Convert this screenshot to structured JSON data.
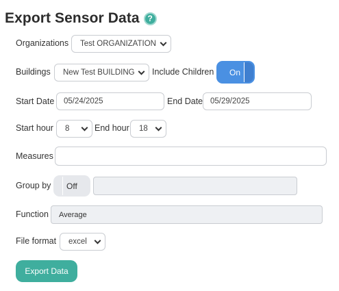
{
  "header": {
    "title": "Export Sensor Data",
    "help_icon_glyph": "?"
  },
  "form": {
    "organizations": {
      "label": "Organizations",
      "value": "Test ORGANIZATION"
    },
    "buildings": {
      "label": "Buildings",
      "value": "New Test BUILDING"
    },
    "include_children": {
      "label": "Include Children",
      "state": "On"
    },
    "start_date": {
      "label": "Start Date",
      "value": "05/24/2025"
    },
    "end_date": {
      "label": "End Date",
      "value": "05/29/2025"
    },
    "start_hour": {
      "label": "Start hour",
      "value": "8"
    },
    "end_hour": {
      "label": "End hour",
      "value": "18"
    },
    "measures": {
      "label": "Measures",
      "value": ""
    },
    "group_by": {
      "label": "Group by",
      "state": "Off",
      "value": ""
    },
    "function": {
      "label": "Function",
      "value": "Average"
    },
    "file_format": {
      "label": "File format",
      "value": "excel"
    },
    "export_button": "Export Data"
  },
  "colors": {
    "accent": "#3fae9e",
    "toggle_on": "#4a90e2",
    "toggle_off": "#e6e8ec"
  },
  "icons": {
    "help": "question-circle-icon",
    "dropdown": "chevron-down-icon"
  }
}
